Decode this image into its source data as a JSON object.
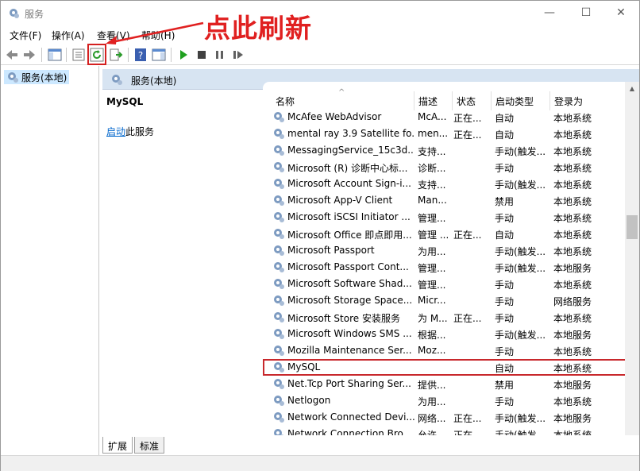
{
  "window": {
    "title": "服务",
    "minimize": "—",
    "maximize": "☐",
    "close": "✕"
  },
  "menu": [
    "文件(F)",
    "操作(A)",
    "查看(V)",
    "帮助(H)"
  ],
  "annotation": {
    "text": "点此刷新"
  },
  "tree": {
    "root": "服务(本地)"
  },
  "header": {
    "title": "服务(本地)"
  },
  "detail": {
    "service_name": "MySQL",
    "action_link": "启动",
    "action_suffix": "此服务"
  },
  "columns": [
    "名称",
    "描述",
    "状态",
    "启动类型",
    "登录为"
  ],
  "rows": [
    {
      "name": "McAfee WebAdvisor",
      "desc": "McA...",
      "status": "正在...",
      "startup": "自动",
      "logon": "本地系统"
    },
    {
      "name": "mental ray 3.9 Satellite fo...",
      "desc": "men...",
      "status": "正在...",
      "startup": "自动",
      "logon": "本地系统"
    },
    {
      "name": "MessagingService_15c3d...",
      "desc": "支持...",
      "status": "",
      "startup": "手动(触发...",
      "logon": "本地系统"
    },
    {
      "name": "Microsoft (R) 诊断中心标...",
      "desc": "诊断...",
      "status": "",
      "startup": "手动",
      "logon": "本地系统"
    },
    {
      "name": "Microsoft Account Sign-i...",
      "desc": "支持...",
      "status": "",
      "startup": "手动(触发...",
      "logon": "本地系统"
    },
    {
      "name": "Microsoft App-V Client",
      "desc": "Man...",
      "status": "",
      "startup": "禁用",
      "logon": "本地系统"
    },
    {
      "name": "Microsoft iSCSI Initiator ...",
      "desc": "管理...",
      "status": "",
      "startup": "手动",
      "logon": "本地系统"
    },
    {
      "name": "Microsoft Office 即点即用...",
      "desc": "管理 ...",
      "status": "正在...",
      "startup": "自动",
      "logon": "本地系统"
    },
    {
      "name": "Microsoft Passport",
      "desc": "为用...",
      "status": "",
      "startup": "手动(触发...",
      "logon": "本地系统"
    },
    {
      "name": "Microsoft Passport Cont...",
      "desc": "管理...",
      "status": "",
      "startup": "手动(触发...",
      "logon": "本地服务"
    },
    {
      "name": "Microsoft Software Shad...",
      "desc": "管理...",
      "status": "",
      "startup": "手动",
      "logon": "本地系统"
    },
    {
      "name": "Microsoft Storage Space...",
      "desc": "Micr...",
      "status": "",
      "startup": "手动",
      "logon": "网络服务"
    },
    {
      "name": "Microsoft Store 安装服务",
      "desc": "为 M...",
      "status": "正在...",
      "startup": "手动",
      "logon": "本地系统"
    },
    {
      "name": "Microsoft Windows SMS ...",
      "desc": "根据...",
      "status": "",
      "startup": "手动(触发...",
      "logon": "本地服务"
    },
    {
      "name": "Mozilla Maintenance Ser...",
      "desc": "Moz...",
      "status": "",
      "startup": "手动",
      "logon": "本地系统"
    },
    {
      "name": "MySQL",
      "desc": "",
      "status": "",
      "startup": "自动",
      "logon": "本地系统"
    },
    {
      "name": "Net.Tcp Port Sharing Ser...",
      "desc": "提供...",
      "status": "",
      "startup": "禁用",
      "logon": "本地服务"
    },
    {
      "name": "Netlogon",
      "desc": "为用...",
      "status": "",
      "startup": "手动",
      "logon": "本地系统"
    },
    {
      "name": "Network Connected Devi...",
      "desc": "网络...",
      "status": "正在...",
      "startup": "手动(触发...",
      "logon": "本地服务"
    },
    {
      "name": "Network Connection Bro...",
      "desc": "允许...",
      "status": "正在...",
      "startup": "手动(触发...",
      "logon": "本地系统"
    }
  ],
  "selected_row": 15,
  "tabs": [
    "扩展",
    "标准"
  ],
  "colors": {
    "accent_red": "#e02020",
    "header_bg": "#d7e4f2",
    "selection": "#cce8ff"
  }
}
